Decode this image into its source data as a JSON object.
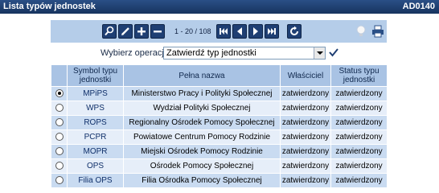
{
  "window": {
    "title": "Lista typów jednostek",
    "code": "AD0140"
  },
  "toolbar": {
    "pager": "1 - 20 / 108",
    "buttons": [
      "search-icon",
      "edit-icon",
      "add-icon",
      "remove-icon",
      "first-page-icon",
      "previous-page-icon",
      "next-page-icon",
      "last-page-icon",
      "refresh-icon",
      "lightbulb-icon",
      "print-icon"
    ]
  },
  "operation": {
    "label": "Wybierz operację:",
    "selected": "Zatwierdź typ jednostki"
  },
  "table": {
    "headers": [
      "",
      "Symbol typu jednostki",
      "Pełna nazwa",
      "Właściciel",
      "Status typu jednostki"
    ],
    "rows": [
      {
        "selected": true,
        "symbol": "MPiPS",
        "name": "Ministerstwo Pracy i Polityki Społecznej",
        "owner": "zatwierdzony",
        "status": "zatwierdzony"
      },
      {
        "selected": false,
        "symbol": "WPS",
        "name": "Wydział Polityki Społecznej",
        "owner": "zatwierdzony",
        "status": "zatwierdzony"
      },
      {
        "selected": false,
        "symbol": "ROPS",
        "name": "Regionalny Ośrodek Pomocy Społecznej",
        "owner": "zatwierdzony",
        "status": "zatwierdzony"
      },
      {
        "selected": false,
        "symbol": "PCPR",
        "name": "Powiatowe Centrum Pomocy Rodzinie",
        "owner": "zatwierdzony",
        "status": "zatwierdzony"
      },
      {
        "selected": false,
        "symbol": "MOPR",
        "name": "Miejski Ośrodek Pomocy Rodzinie",
        "owner": "zatwierdzony",
        "status": "zatwierdzony"
      },
      {
        "selected": false,
        "symbol": "OPS",
        "name": "Ośrodek Pomocy Społecznej",
        "owner": "zatwierdzony",
        "status": "zatwierdzony"
      },
      {
        "selected": false,
        "symbol": "Filia OPS",
        "name": "Filia Ośrodka Pomocy Społecznej",
        "owner": "zatwierdzony",
        "status": "zatwierdzony"
      }
    ]
  }
}
